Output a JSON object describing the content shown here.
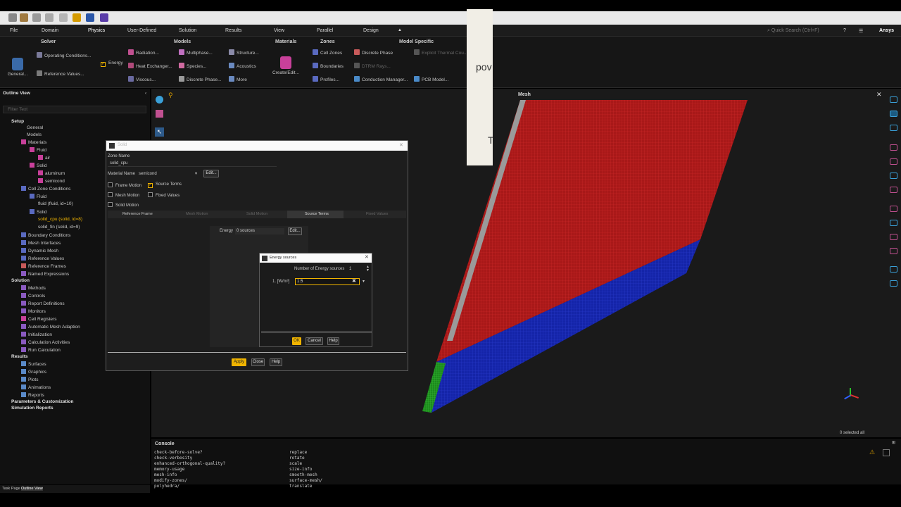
{
  "menubar": {
    "items": [
      "File",
      "Domain",
      "Physics",
      "User-Defined",
      "Solution",
      "Results",
      "View",
      "Parallel",
      "Design"
    ],
    "search_placeholder": "Quick Search (Ctrl+F)",
    "brand": "Ansys"
  },
  "ribbon": {
    "solver": {
      "title": "Solver",
      "general": "General...",
      "operating": "Operating Conditions...",
      "reference": "Reference Values..."
    },
    "models": {
      "title": "Models",
      "energy": "Energy",
      "radiation": "Radiation...",
      "heat_exchanger": "Heat Exchanger...",
      "viscous": "Viscous...",
      "multiphase": "Multiphase...",
      "species": "Species...",
      "discrete_phase": "Discrete Phase...",
      "structure": "Structure...",
      "acoustics": "Acoustics",
      "more": "More"
    },
    "materials": {
      "title": "Materials",
      "create": "Create/Edit..."
    },
    "zones": {
      "title": "Zones",
      "cell_zones": "Cell Zones",
      "boundaries": "Boundaries",
      "profiles": "Profiles..."
    },
    "model_specific": {
      "title": "Model Specific",
      "discrete_phase": "Discrete Phase",
      "dtrm": "DTRM Rays...",
      "conduction": "Conduction Manager...",
      "explicit": "Explicit Thermal Cou...",
      "pcb": "PCB Model..."
    }
  },
  "outline": {
    "title": "Outline View",
    "filter_placeholder": "Filter Text",
    "nodes": [
      "Setup",
      "General",
      "Models",
      "Materials",
      "Fluid",
      "air",
      "Solid",
      "aluminum",
      "semicond",
      "Cell Zone Conditions",
      "Fluid",
      "fluid (fluid, id=10)",
      "Solid",
      "solid_cpu (solid, id=8)",
      "solid_fin (solid, id=9)",
      "Boundary Conditions",
      "Mesh Interfaces",
      "Dynamic Mesh",
      "Reference Values",
      "Reference Frames",
      "Named Expressions",
      "Solution",
      "Methods",
      "Controls",
      "Report Definitions",
      "Monitors",
      "Cell Registers",
      "Automatic Mesh Adaption",
      "Initialization",
      "Calculation Activities",
      "Run Calculation",
      "Results",
      "Surfaces",
      "Graphics",
      "Plots",
      "Animations",
      "Reports",
      "Parameters & Customization",
      "Simulation Reports"
    ],
    "tabs": [
      "Task Page",
      "Outline View"
    ]
  },
  "solid_dialog": {
    "title": "Solid",
    "zone_name_label": "Zone Name",
    "zone_name": "solid_cpu",
    "material_label": "Material Name",
    "material": "semicond",
    "edit": "Edit...",
    "checks": {
      "frame_motion": "Frame Motion",
      "source_terms": "Source Terms",
      "mesh_motion": "Mesh Motion",
      "fixed_values": "Fixed Values",
      "solid_motion": "Solid Motion"
    },
    "tabs": [
      "Reference Frame",
      "Mesh Motion",
      "Solid Motion",
      "Source Terms",
      "Fixed Values"
    ],
    "energy_label": "Energy",
    "energy_value": "0 sources",
    "energy_edit": "Edit...",
    "apply": "Apply",
    "close": "Close",
    "help": "Help"
  },
  "energy_dialog": {
    "title": "Energy sources",
    "num_label": "Number of Energy sources",
    "num_value": "1",
    "row_label": "1. [W/m³]",
    "row_value": "1.5",
    "ok": "OK",
    "cancel": "Cancel",
    "help": "Help"
  },
  "mesh_panel": {
    "title": "Mesh",
    "selected": "0 selected all"
  },
  "popup": {
    "text1": "pov",
    "text2": "T"
  },
  "console": {
    "title": "Console",
    "col1": [
      "check-before-solve?",
      "check-verbosity",
      "enhanced-orthogonal-quality?",
      "memory-usage",
      "mesh-info",
      "modify-zones/",
      "polyhedra/",
      "quality"
    ],
    "col2": [
      "replace",
      "rotate",
      "scale",
      "size-info",
      "smooth-mesh",
      "surface-mesh/",
      "translate"
    ]
  },
  "colors": {
    "accent": "#f0b400",
    "solid_red": "#b01818",
    "solid_blue": "#1424a8",
    "solid_green": "#1c8a1c"
  }
}
